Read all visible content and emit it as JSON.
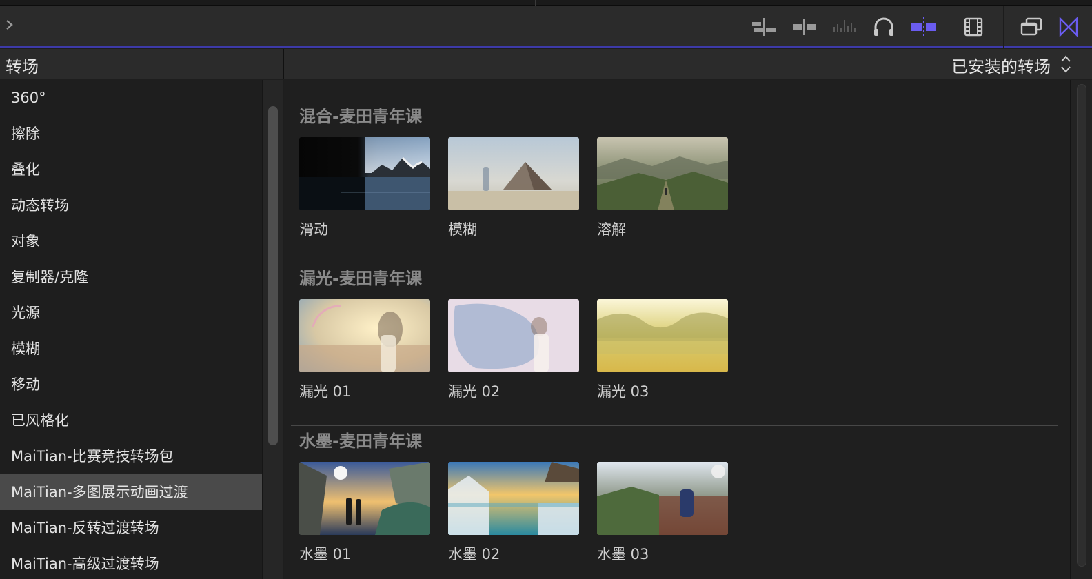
{
  "toolbar": {
    "icons": [
      "append-icon",
      "insert-icon",
      "audio-waveform-icon",
      "headphones-icon",
      "snapping-icon",
      "filmstrip-icon",
      "window-icon",
      "transitions-icon"
    ],
    "accent_color": "#6a5cf0"
  },
  "panel": {
    "title": "转场",
    "filter_label": "已安装的转场"
  },
  "sidebar": {
    "items": [
      {
        "label": "360°"
      },
      {
        "label": "擦除"
      },
      {
        "label": "叠化"
      },
      {
        "label": "动态转场"
      },
      {
        "label": "对象"
      },
      {
        "label": "复制器/克隆"
      },
      {
        "label": "光源"
      },
      {
        "label": "模糊"
      },
      {
        "label": "移动"
      },
      {
        "label": "已风格化"
      },
      {
        "label": "MaiTian-比赛竞技转场包"
      },
      {
        "label": "MaiTian-多图展示动画过渡"
      },
      {
        "label": "MaiTian-反转过渡转场"
      },
      {
        "label": "MaiTian-高级过渡转场"
      }
    ],
    "selected_index": 11
  },
  "groups": [
    {
      "title": "混合-麦田青年课",
      "items": [
        {
          "label": "滑动"
        },
        {
          "label": "模糊"
        },
        {
          "label": "溶解"
        }
      ]
    },
    {
      "title": "漏光-麦田青年课",
      "items": [
        {
          "label": "漏光 01"
        },
        {
          "label": "漏光 02"
        },
        {
          "label": "漏光 03"
        }
      ]
    },
    {
      "title": "水墨-麦田青年课",
      "items": [
        {
          "label": "水墨 01"
        },
        {
          "label": "水墨 02"
        },
        {
          "label": "水墨 03"
        }
      ]
    }
  ]
}
